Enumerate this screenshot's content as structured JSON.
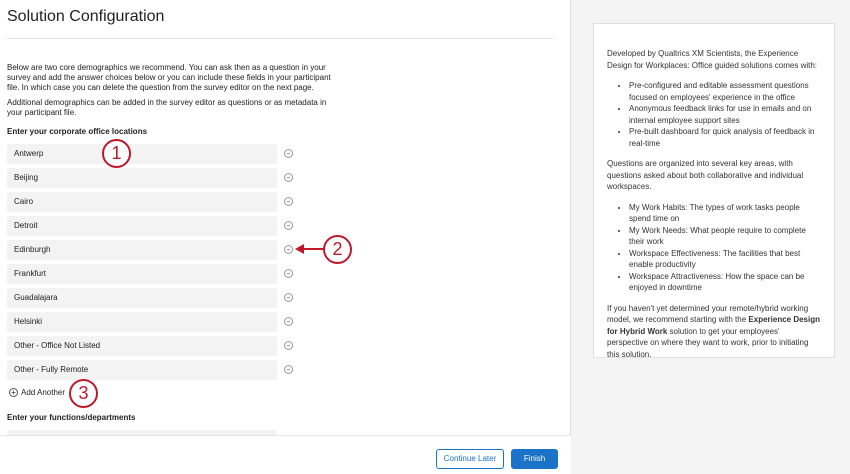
{
  "page_title": "Solution Configuration",
  "intro": [
    "Below are two core demographics we recommend. You can ask then as a question in your survey and add the answer choices below or you can include these fields in your participant file. In which case you can delete the question from the survey editor on the next page.",
    "Additional demographics can be added in the survey editor as questions or as metadata in your participant file."
  ],
  "locations_heading": "Enter your corporate office locations",
  "locations": [
    "Antwerp",
    "Beijing",
    "Cairo",
    "Detroit",
    "Edinburgh",
    "Frankfurt",
    "Guadalajara",
    "Helsinki",
    "Other - Office Not Listed",
    "Other - Fully Remote"
  ],
  "add_another": "Add Another",
  "functions_heading": "Enter your functions/departments",
  "footer": {
    "continue_later": "Continue Later",
    "finish": "Finish"
  },
  "annotations": [
    "1",
    "2",
    "3"
  ],
  "info": {
    "p1": "Developed by Qualtrics XM Scientists, the Experience Design for Workplaces: Office guided solutions comes with:",
    "list1": [
      "Pre-configured and editable assessment questions focused on employees' experience in the office",
      "Anonymous feedback links for use in emails and on internal employee support sites",
      "Pre-built dashboard for quick analysis of feedback in real-time"
    ],
    "p2": "Questions are organized into several key areas, with questions asked about both collaborative and individual workspaces.",
    "list2": [
      "My Work Habits: The types of work tasks people spend time on",
      "My Work Needs: What people require to complete their work",
      "Workspace Effectiveness: The facilities that best enable productivity",
      "Workspace Attractiveness: How the space can be enjoyed in downtime"
    ],
    "p3_a": "If you haven't yet determined your remote/hybrid working model, we recommend starting with the ",
    "p3_bold": "Experience Design for Hybrid Work",
    "p3_b": " solution to get your employees' perspective on where they want to work, prior to initiating this solution."
  },
  "accent": "#1a73c8",
  "annotation_color": "#c0182b"
}
